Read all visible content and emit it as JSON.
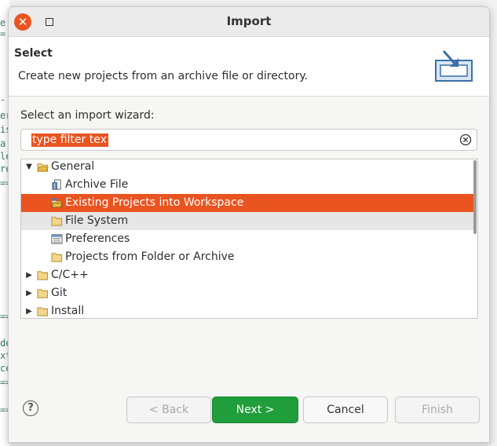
{
  "background_editor": {
    "fragments": [
      "e",
      "=",
      "-",
      "er",
      "is",
      " a",
      "le",
      "re",
      "==",
      "==",
      "de",
      "xt",
      "ce",
      "==",
      "=="
    ]
  },
  "window": {
    "title": "Import",
    "close_icon": "close-icon",
    "maximize_icon": "maximize-icon"
  },
  "header": {
    "title": "Select",
    "description": "Create new projects from an archive file or directory.",
    "icon": "import-wizard-icon"
  },
  "wizard_label": "Select an import wizard:",
  "filter": {
    "value": "type filter text",
    "clear_icon": "clear-icon"
  },
  "tree": {
    "items": [
      {
        "label": "General",
        "level": 0,
        "expanded": true,
        "icon": "folder-open-icon"
      },
      {
        "label": "Archive File",
        "level": 1,
        "icon": "archive-file-icon"
      },
      {
        "label": "Existing Projects into Workspace",
        "level": 1,
        "icon": "project-folder-icon",
        "selected": true
      },
      {
        "label": "File System",
        "level": 1,
        "icon": "folder-icon",
        "hover": true
      },
      {
        "label": "Preferences",
        "level": 1,
        "icon": "preferences-icon"
      },
      {
        "label": "Projects from Folder or Archive",
        "level": 1,
        "icon": "folder-icon"
      },
      {
        "label": "C/C++",
        "level": 0,
        "expanded": false,
        "icon": "folder-icon"
      },
      {
        "label": "Git",
        "level": 0,
        "expanded": false,
        "icon": "folder-icon"
      },
      {
        "label": "Install",
        "level": 0,
        "expanded": false,
        "icon": "folder-icon"
      }
    ]
  },
  "buttons": {
    "help": "?",
    "back": "< Back",
    "next": "Next >",
    "cancel": "Cancel",
    "finish": "Finish"
  },
  "colors": {
    "accent": "#e95420",
    "primary_button": "#1f9e3b",
    "folder": "#e8b84a"
  }
}
